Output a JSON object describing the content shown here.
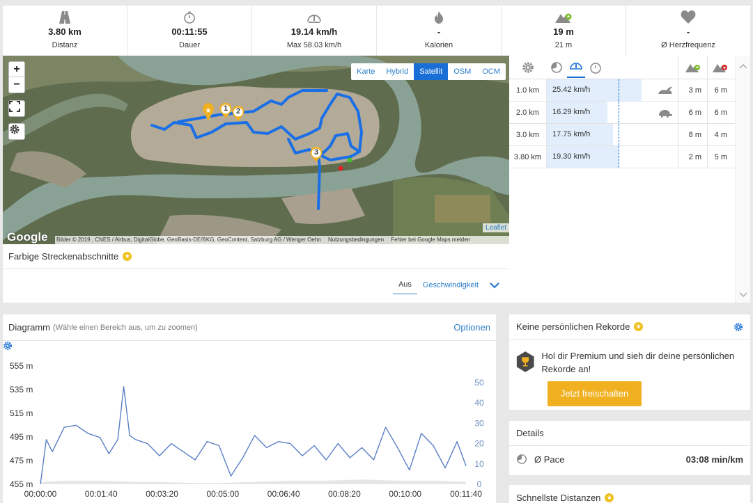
{
  "stats": [
    {
      "icon": "road-icon",
      "value": "3.80 km",
      "label": "Distanz"
    },
    {
      "icon": "stopwatch-icon",
      "value": "00:11:55",
      "label": "Dauer"
    },
    {
      "icon": "speedometer-icon",
      "value": "19.14 km/h",
      "label": "Max 58.03 km/h"
    },
    {
      "icon": "flame-icon",
      "value": "-",
      "label": "Kalorien"
    },
    {
      "icon": "mountain-up-icon",
      "value": "19 m",
      "label": "21 m"
    },
    {
      "icon": "heart-icon",
      "value": "-",
      "label": "Ø Herzfrequenz"
    }
  ],
  "map": {
    "layers": [
      "Karte",
      "Hybrid",
      "Satellit",
      "OSM",
      "OCM"
    ],
    "active_layer": "Satellit",
    "zoom_in": "+",
    "zoom_out": "−",
    "google_logo": "Google",
    "leaflet": "Leaflet",
    "attribution": "Bilder © 2019 , CNES / Airbus, DigitalGlobe, GeoBasis-DE/BKG, GeoContent, Salzburg AG / Wenger Oehn",
    "terms": "Nutzungsbedingungen",
    "report": "Fehler bei Google Maps melden",
    "markers": [
      "1",
      "2",
      "3"
    ]
  },
  "colored_sections": {
    "label": "Farbige Streckenabschnitte",
    "tab_off": "Aus",
    "tab_speed": "Geschwindigkeit"
  },
  "splits": {
    "rows": [
      {
        "km": "1.0 km",
        "speed": "25.42 km/h",
        "speed_value": 25.42,
        "icon": "rabbit-icon",
        "up": "3 m",
        "down": "6 m"
      },
      {
        "km": "2.0 km",
        "speed": "16.29 km/h",
        "speed_value": 16.29,
        "icon": "turtle-icon",
        "up": "6 m",
        "down": "6 m"
      },
      {
        "km": "3.0 km",
        "speed": "17.75 km/h",
        "speed_value": 17.75,
        "icon": "",
        "up": "8 m",
        "down": "4 m"
      },
      {
        "km": "3.80 km",
        "speed": "19.30 km/h",
        "speed_value": 19.3,
        "icon": "",
        "up": "2 m",
        "down": "5 m"
      }
    ]
  },
  "diagram": {
    "title": "Diagramm",
    "hint": "(Wähle einen Bereich aus, um zu zoomen)",
    "options": "Optionen"
  },
  "chart_data": {
    "type": "line",
    "ylim_left": [
      455,
      555
    ],
    "yticks_left": [
      "555 m",
      "535 m",
      "515 m",
      "495 m",
      "475 m",
      "455 m"
    ],
    "ylim_right": [
      0,
      50
    ],
    "yticks_right": [
      "50",
      "40",
      "30",
      "20",
      "10",
      "0"
    ],
    "xticks": [
      "00:00:00",
      "00:01:40",
      "00:03:20",
      "00:05:00",
      "00:06:40",
      "00:08:20",
      "00:10:00",
      "00:11:40"
    ],
    "xlim_seconds": [
      0,
      715
    ],
    "speed_series": {
      "t": [
        0,
        10,
        20,
        40,
        60,
        80,
        100,
        115,
        130,
        140,
        150,
        160,
        170,
        180,
        200,
        220,
        240,
        260,
        280,
        300,
        320,
        340,
        360,
        380,
        400,
        420,
        440,
        460,
        480,
        500,
        520,
        540,
        560,
        580,
        600,
        620,
        640,
        660,
        680,
        700,
        715
      ],
      "v": [
        0,
        22,
        16,
        28,
        29,
        25,
        23,
        15,
        22,
        48,
        24,
        22,
        21,
        20,
        14,
        20,
        16,
        12,
        21,
        19,
        4,
        13,
        24,
        18,
        21,
        20,
        14,
        19,
        12,
        20,
        13,
        18,
        12,
        28,
        18,
        7,
        25,
        19,
        8,
        21,
        9
      ]
    },
    "elevation_series": {
      "t": [
        0,
        40,
        100,
        160,
        200,
        260,
        300,
        360,
        420,
        480,
        540,
        600,
        660,
        715
      ],
      "v": [
        457,
        458,
        458,
        457,
        457,
        456,
        456,
        457,
        458,
        458,
        459,
        458,
        458,
        457
      ]
    }
  },
  "records": {
    "title": "Keine persönlichen Rekorde",
    "text": "Hol dir Premium und sieh dir deine persönlichen Rekorde an!",
    "button": "Jetzt freischalten"
  },
  "details": {
    "title": "Details",
    "pace_label": "Ø Pace",
    "pace_value": "03:08 min/km"
  },
  "fastest": {
    "title": "Schnellste Distanzen"
  }
}
